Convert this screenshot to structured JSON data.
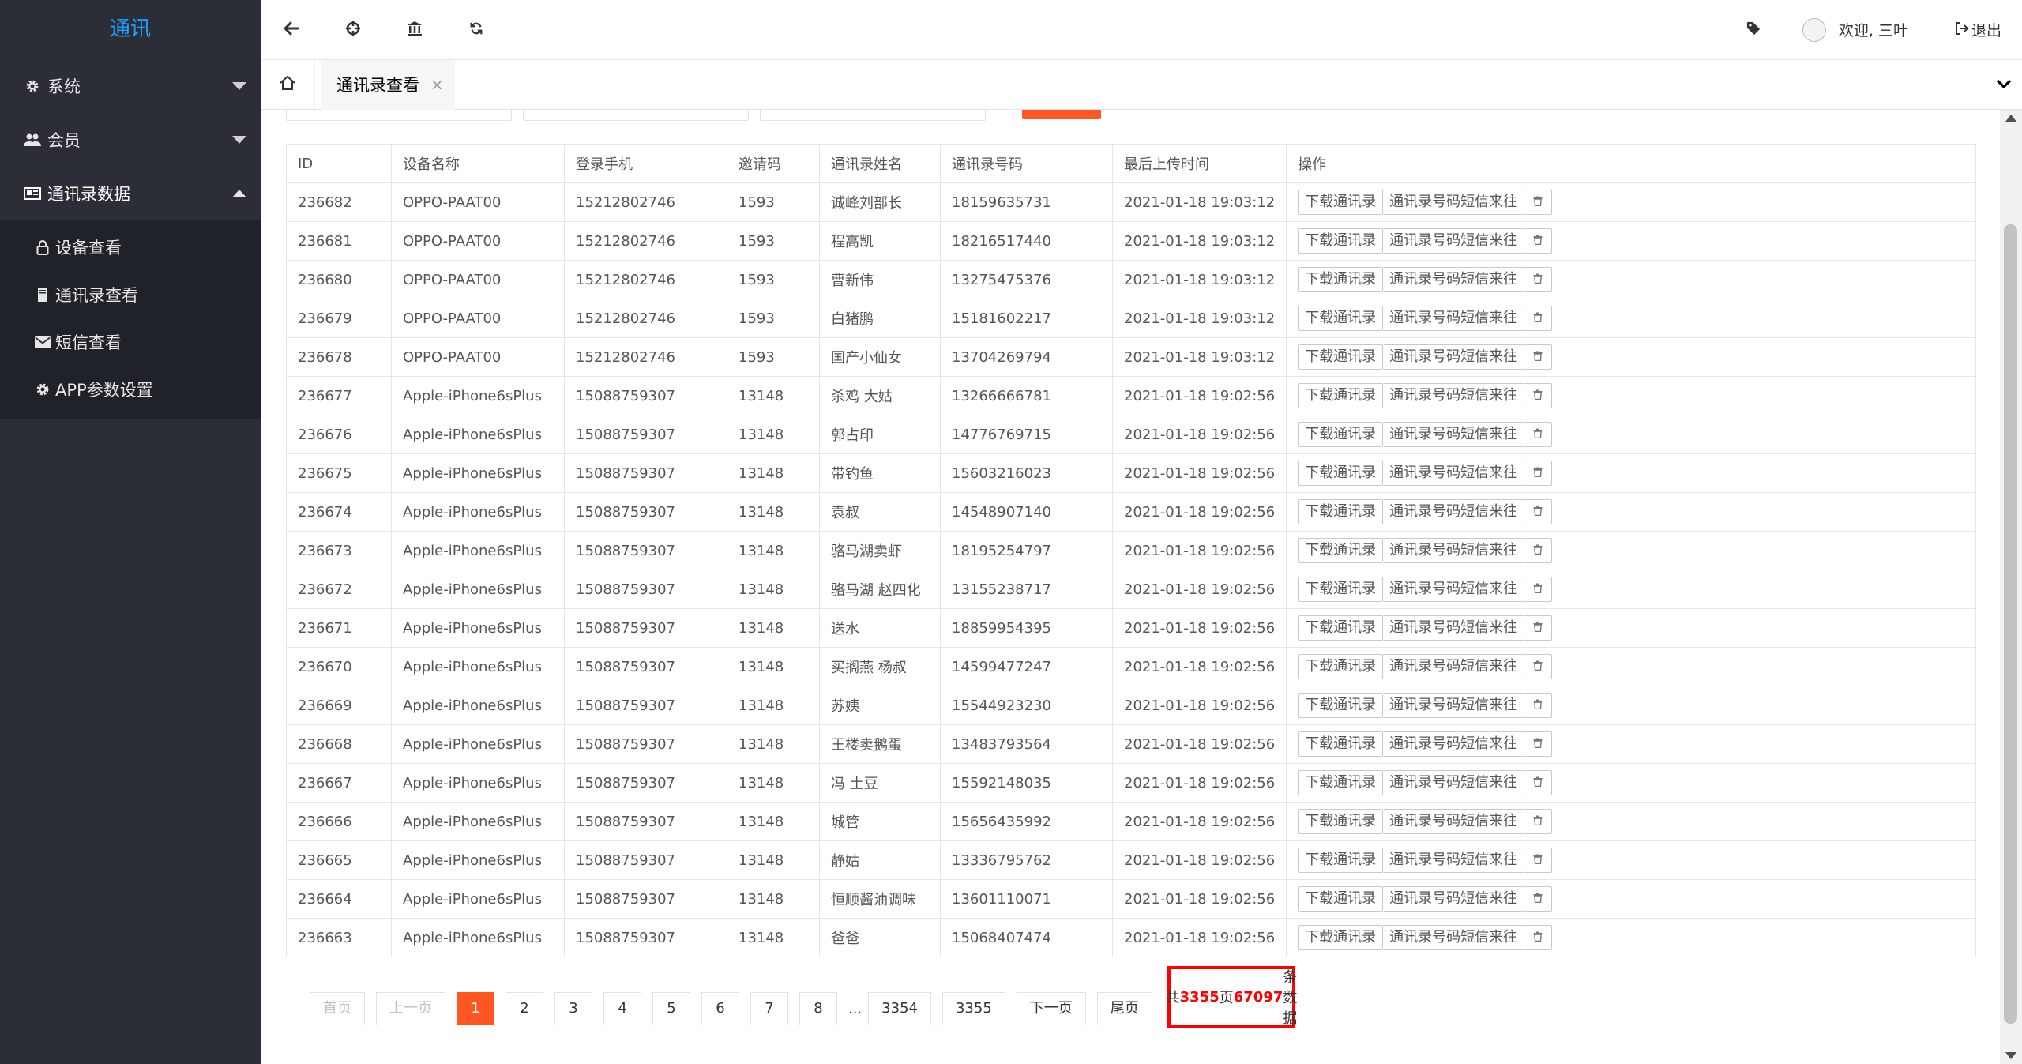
{
  "brand": "通讯",
  "sidebar": {
    "items": [
      {
        "label": "系统",
        "icon": "gear-icon"
      },
      {
        "label": "会员",
        "icon": "users-icon"
      },
      {
        "label": "通讯录数据",
        "icon": "id-card-icon"
      }
    ],
    "subitems": [
      {
        "label": "设备查看",
        "icon": "lock-icon"
      },
      {
        "label": "通讯录查看",
        "icon": "book-icon"
      },
      {
        "label": "短信查看",
        "icon": "envelope-icon"
      },
      {
        "label": "APP参数设置",
        "icon": "gear-icon"
      }
    ]
  },
  "topbar": {
    "welcome": "欢迎, 三叶",
    "logout": "退出"
  },
  "tabs": {
    "active": "通讯录查看",
    "close": "×"
  },
  "table": {
    "headers": [
      "ID",
      "设备名称",
      "登录手机",
      "邀请码",
      "通讯录姓名",
      "通讯录号码",
      "最后上传时间",
      "操作"
    ],
    "actions": {
      "download": "下载通讯录",
      "sms": "通讯录号码短信来往"
    },
    "rows": [
      [
        "236682",
        "OPPO-PAAT00",
        "15212802746",
        "1593",
        "诚峰刘部长",
        "18159635731",
        "2021-01-18 19:03:12"
      ],
      [
        "236681",
        "OPPO-PAAT00",
        "15212802746",
        "1593",
        "程高凯",
        "18216517440",
        "2021-01-18 19:03:12"
      ],
      [
        "236680",
        "OPPO-PAAT00",
        "15212802746",
        "1593",
        "曹新伟",
        "13275475376",
        "2021-01-18 19:03:12"
      ],
      [
        "236679",
        "OPPO-PAAT00",
        "15212802746",
        "1593",
        "白猪鹏",
        "15181602217",
        "2021-01-18 19:03:12"
      ],
      [
        "236678",
        "OPPO-PAAT00",
        "15212802746",
        "1593",
        "国产小仙女",
        "13704269794",
        "2021-01-18 19:03:12"
      ],
      [
        "236677",
        "Apple-iPhone6sPlus",
        "15088759307",
        "13148",
        "杀鸡 大姑",
        "13266666781",
        "2021-01-18 19:02:56"
      ],
      [
        "236676",
        "Apple-iPhone6sPlus",
        "15088759307",
        "13148",
        "郭占印",
        "14776769715",
        "2021-01-18 19:02:56"
      ],
      [
        "236675",
        "Apple-iPhone6sPlus",
        "15088759307",
        "13148",
        "带钓鱼",
        "15603216023",
        "2021-01-18 19:02:56"
      ],
      [
        "236674",
        "Apple-iPhone6sPlus",
        "15088759307",
        "13148",
        "袁叔",
        "14548907140",
        "2021-01-18 19:02:56"
      ],
      [
        "236673",
        "Apple-iPhone6sPlus",
        "15088759307",
        "13148",
        "骆马湖卖虾",
        "18195254797",
        "2021-01-18 19:02:56"
      ],
      [
        "236672",
        "Apple-iPhone6sPlus",
        "15088759307",
        "13148",
        "骆马湖 赵四化",
        "13155238717",
        "2021-01-18 19:02:56"
      ],
      [
        "236671",
        "Apple-iPhone6sPlus",
        "15088759307",
        "13148",
        "送水",
        "18859954395",
        "2021-01-18 19:02:56"
      ],
      [
        "236670",
        "Apple-iPhone6sPlus",
        "15088759307",
        "13148",
        "买搁燕 杨叔",
        "14599477247",
        "2021-01-18 19:02:56"
      ],
      [
        "236669",
        "Apple-iPhone6sPlus",
        "15088759307",
        "13148",
        "苏姨",
        "15544923230",
        "2021-01-18 19:02:56"
      ],
      [
        "236668",
        "Apple-iPhone6sPlus",
        "15088759307",
        "13148",
        "王楼卖鹅蛋",
        "13483793564",
        "2021-01-18 19:02:56"
      ],
      [
        "236667",
        "Apple-iPhone6sPlus",
        "15088759307",
        "13148",
        "冯 土豆",
        "15592148035",
        "2021-01-18 19:02:56"
      ],
      [
        "236666",
        "Apple-iPhone6sPlus",
        "15088759307",
        "13148",
        "城管",
        "15656435992",
        "2021-01-18 19:02:56"
      ],
      [
        "236665",
        "Apple-iPhone6sPlus",
        "15088759307",
        "13148",
        "静姑",
        "13336795762",
        "2021-01-18 19:02:56"
      ],
      [
        "236664",
        "Apple-iPhone6sPlus",
        "15088759307",
        "13148",
        "恒顺酱油调味",
        "13601110071",
        "2021-01-18 19:02:56"
      ],
      [
        "236663",
        "Apple-iPhone6sPlus",
        "15088759307",
        "13148",
        "爸爸",
        "15068407474",
        "2021-01-18 19:02:56"
      ]
    ]
  },
  "pagination": {
    "first": "首页",
    "prev": "上一页",
    "pages": [
      "1",
      "2",
      "3",
      "4",
      "5",
      "6",
      "7",
      "8"
    ],
    "ellipsis": "...",
    "tail_pages": [
      "3354",
      "3355"
    ],
    "next": "下一页",
    "last": "尾页",
    "summary": {
      "prefix": "共",
      "total_pages": "3355",
      "mid": "页",
      "total_records": "67097",
      "suffix": "条数据"
    }
  },
  "colors": {
    "sidebar_bg": "#2b2e37",
    "brand": "#1e9fff",
    "accent": "#ff5722",
    "highlight_border": "#ff0000"
  }
}
